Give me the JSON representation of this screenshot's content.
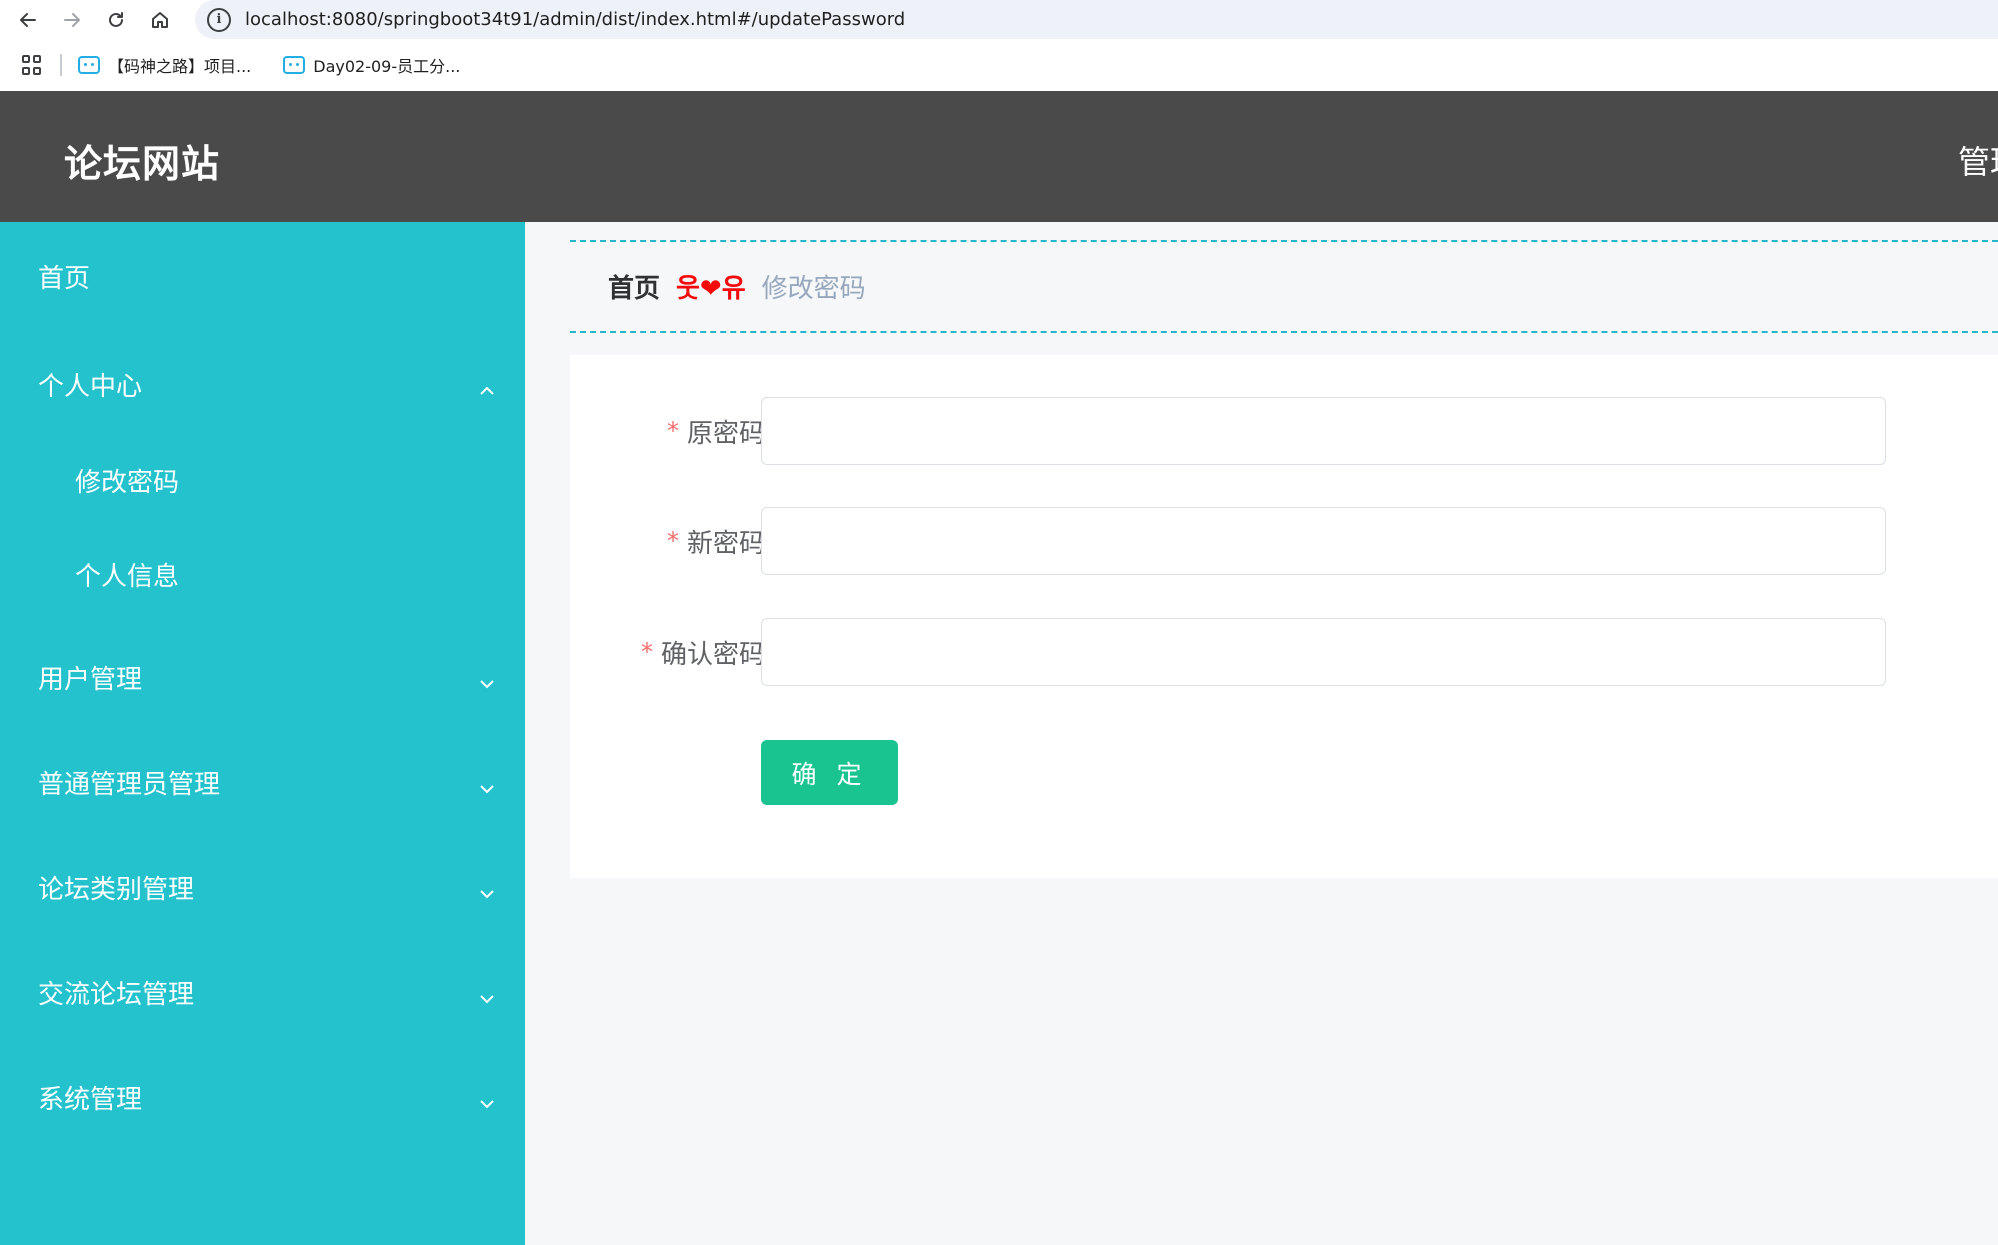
{
  "browser": {
    "url": "localhost:8080/springboot34t91/admin/dist/index.html#/updatePassword",
    "bookmarks": [
      {
        "label": "【码神之路】项目..."
      },
      {
        "label": "Day02-09-员工分..."
      }
    ]
  },
  "header": {
    "title": "论坛网站",
    "right_text": "管理"
  },
  "sidebar": {
    "items": [
      {
        "label": "首页"
      },
      {
        "label": "个人中心"
      },
      {
        "label": "修改密码"
      },
      {
        "label": "个人信息"
      },
      {
        "label": "用户管理"
      },
      {
        "label": "普通管理员管理"
      },
      {
        "label": "论坛类别管理"
      },
      {
        "label": "交流论坛管理"
      },
      {
        "label": "系统管理"
      }
    ]
  },
  "breadcrumb": {
    "home": "首页",
    "separator": "웃❤유",
    "current": "修改密码"
  },
  "form": {
    "fields": [
      {
        "label": "原密码",
        "value": "",
        "required": "*"
      },
      {
        "label": "新密码",
        "value": "",
        "required": "*"
      },
      {
        "label": "确认密码",
        "value": "",
        "required": "*"
      }
    ],
    "submit_label": "确 定"
  },
  "colors": {
    "sidebar_bg": "#24c2cc",
    "header_bg": "#4a4a4a",
    "submit_bg": "#19c491",
    "breadcrumb_border": "#26b6cc",
    "separator_red": "#f40a0a"
  }
}
